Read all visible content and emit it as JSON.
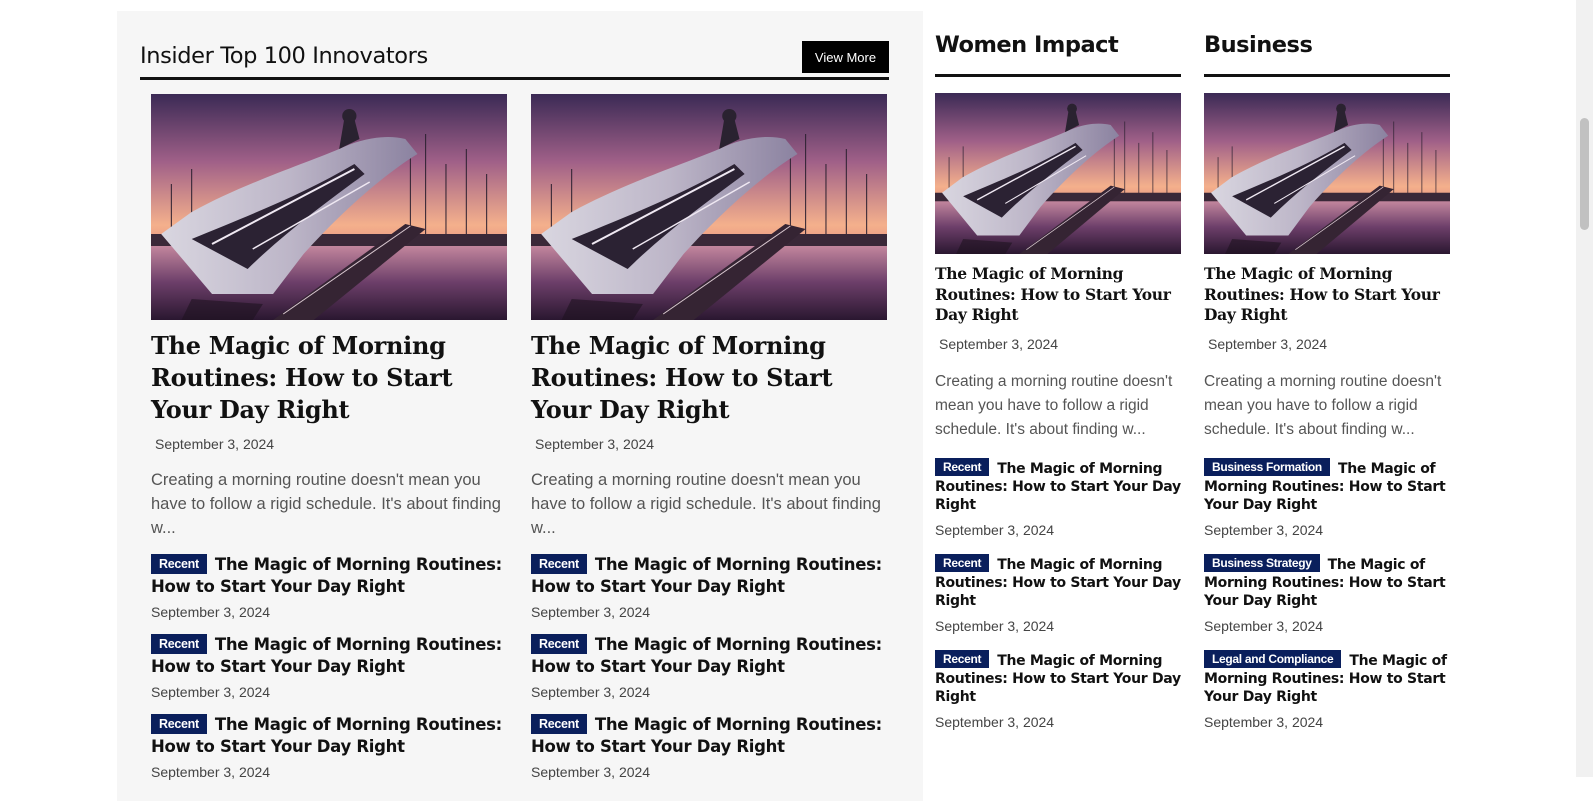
{
  "left_section": {
    "title": "Insider Top 100 Innovators",
    "view_more_label": "View More",
    "columns": [
      {
        "featured": {
          "title": "The Magic of Morning Routines: How to Start Your Day Right",
          "date": "September 3, 2024",
          "excerpt": "Creating a morning routine doesn't mean you have to follow a rigid schedule. It's about finding w..."
        },
        "list": [
          {
            "badge": "Recent",
            "title": "The Magic of Morning Routines: How to Start Your Day Right",
            "date": "September 3, 2024"
          },
          {
            "badge": "Recent",
            "title": "The Magic of Morning Routines: How to Start Your Day Right",
            "date": "September 3, 2024"
          },
          {
            "badge": "Recent",
            "title": "The Magic of Morning Routines: How to Start Your Day Right",
            "date": "September 3, 2024"
          }
        ]
      },
      {
        "featured": {
          "title": "The Magic of Morning Routines: How to Start Your Day Right",
          "date": "September 3, 2024",
          "excerpt": "Creating a morning routine doesn't mean you have to follow a rigid schedule. It's about finding w..."
        },
        "list": [
          {
            "badge": "Recent",
            "title": "The Magic of Morning Routines: How to Start Your Day Right",
            "date": "September 3, 2024"
          },
          {
            "badge": "Recent",
            "title": "The Magic of Morning Routines: How to Start Your Day Right",
            "date": "September 3, 2024"
          },
          {
            "badge": "Recent",
            "title": "The Magic of Morning Routines: How to Start Your Day Right",
            "date": "September 3, 2024"
          }
        ]
      }
    ]
  },
  "women_impact": {
    "title": "Women Impact",
    "featured": {
      "title": "The Magic of Morning Routines: How to Start Your Day Right",
      "date": "September 3, 2024",
      "excerpt": "Creating a morning routine doesn't mean you have to follow a rigid schedule. It's about finding w..."
    },
    "list": [
      {
        "badge": "Recent",
        "title": "The Magic of Morning Routines: How to Start Your Day Right",
        "date": "September 3, 2024"
      },
      {
        "badge": "Recent",
        "title": "The Magic of Morning Routines: How to Start Your Day Right",
        "date": "September 3, 2024"
      },
      {
        "badge": "Recent",
        "title": "The Magic of Morning Routines: How to Start Your Day Right",
        "date": "September 3, 2024"
      }
    ]
  },
  "business": {
    "title": "Business",
    "featured": {
      "title": "The Magic of Morning Routines: How to Start Your Day Right",
      "date": "September 3, 2024",
      "excerpt": "Creating a morning routine doesn't mean you have to follow a rigid schedule. It's about finding w..."
    },
    "list": [
      {
        "badge": "Business Formation",
        "title": "The Magic of Morning Routines: How to Start Your Day Right",
        "date": "September 3, 2024"
      },
      {
        "badge": "Business Strategy",
        "title": "The Magic of Morning Routines: How to Start Your Day Right",
        "date": "September 3, 2024"
      },
      {
        "badge": "Legal and Compliance",
        "title": "The Magic of Morning Routines: How to Start Your Day Right",
        "date": "September 3, 2024"
      }
    ]
  },
  "colors": {
    "badge_bg": "#0a1f5c",
    "panel_bg": "#f6f6f6",
    "button_bg": "#000000"
  }
}
